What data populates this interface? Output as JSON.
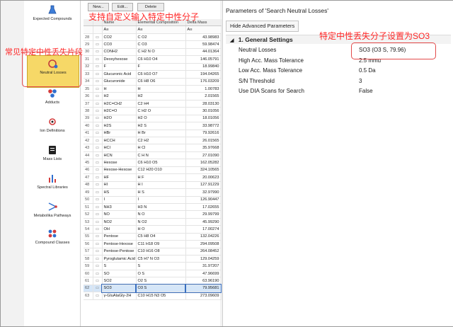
{
  "toolbar": {
    "new": "New...",
    "edit": "Edit...",
    "delete": "Delete"
  },
  "nav": [
    {
      "label": "Expected Compounds",
      "icon": "flask-icon"
    },
    {
      "label": "Adducts",
      "icon": "adducts-icon"
    },
    {
      "label": "Neutral Losses",
      "icon": "neutral-loss-icon"
    },
    {
      "label": "Ion Definitions",
      "icon": "ion-definitions-icon"
    },
    {
      "label": "Mass Lists",
      "icon": "mass-list-icon"
    },
    {
      "label": "Spectral Libraries",
      "icon": "spectral-library-icon"
    },
    {
      "label": "Metabolika Pathways",
      "icon": "pathway-icon"
    },
    {
      "label": "Compound Classes",
      "icon": "compound-classes-icon"
    }
  ],
  "table": {
    "headers": {
      "name": "Name",
      "composition": "Elemental Composition",
      "mass": "Delta Mass"
    },
    "filter_symbol": "A≡",
    "rows": [
      {
        "n": "28",
        "name": "CO2",
        "comp": "C O2",
        "mass": "43.98983"
      },
      {
        "n": "29",
        "name": "CO3",
        "comp": "C O3",
        "mass": "59.98474"
      },
      {
        "n": "30",
        "name": "CONH2",
        "comp": "C H2 N O",
        "mass": "44.01364"
      },
      {
        "n": "31",
        "name": "Deoxyhexose",
        "comp": "C6 H10 O4",
        "mass": "146.05791"
      },
      {
        "n": "32",
        "name": "F",
        "comp": "F",
        "mass": "18.99840"
      },
      {
        "n": "33",
        "name": "Glucuronic Acid",
        "comp": "C6 H10 O7",
        "mass": "194.04265"
      },
      {
        "n": "34",
        "name": "Glucuronide",
        "comp": "C6 H8 O6",
        "mass": "176.03209"
      },
      {
        "n": "35",
        "name": "H",
        "comp": "H",
        "mass": "1.00783"
      },
      {
        "n": "36",
        "name": "H2",
        "comp": "H2",
        "mass": "2.01565"
      },
      {
        "n": "37",
        "name": "H2C=CH2",
        "comp": "C2 H4",
        "mass": "28.03130"
      },
      {
        "n": "38",
        "name": "H2C=O",
        "comp": "C H2 O",
        "mass": "30.01056"
      },
      {
        "n": "39",
        "name": "H2O",
        "comp": "H2 O",
        "mass": "18.01056"
      },
      {
        "n": "40",
        "name": "H2S",
        "comp": "H2 S",
        "mass": "33.98772"
      },
      {
        "n": "41",
        "name": "HBr",
        "comp": "H Br",
        "mass": "79.92616"
      },
      {
        "n": "42",
        "name": "HCCH",
        "comp": "C2 H2",
        "mass": "26.01565"
      },
      {
        "n": "43",
        "name": "HCl",
        "comp": "H Cl",
        "mass": "35.97668"
      },
      {
        "n": "44",
        "name": "HCN",
        "comp": "C H N",
        "mass": "27.01090"
      },
      {
        "n": "45",
        "name": "Hexose",
        "comp": "C6 H10 O5",
        "mass": "162.05282"
      },
      {
        "n": "46",
        "name": "Hexose-Hexose",
        "comp": "C12 H20 O10",
        "mass": "324.10565"
      },
      {
        "n": "47",
        "name": "HF",
        "comp": "H F",
        "mass": "20.00623"
      },
      {
        "n": "48",
        "name": "HI",
        "comp": "H I",
        "mass": "127.91229"
      },
      {
        "n": "49",
        "name": "HS",
        "comp": "H S",
        "mass": "32.97990"
      },
      {
        "n": "50",
        "name": "I",
        "comp": "I",
        "mass": "126.90447"
      },
      {
        "n": "51",
        "name": "NH3",
        "comp": "H3 N",
        "mass": "17.02655"
      },
      {
        "n": "52",
        "name": "NO",
        "comp": "N O",
        "mass": "29.99799"
      },
      {
        "n": "53",
        "name": "NO2",
        "comp": "N O2",
        "mass": "45.99290"
      },
      {
        "n": "54",
        "name": "OH",
        "comp": "H O",
        "mass": "17.00274"
      },
      {
        "n": "55",
        "name": "Pentose",
        "comp": "C5 H8 O4",
        "mass": "132.04226"
      },
      {
        "n": "56",
        "name": "Pentose-Hexose",
        "comp": "C11 H18 O9",
        "mass": "294.09508"
      },
      {
        "n": "57",
        "name": "Pentose-Pentose",
        "comp": "C10 H16 O8",
        "mass": "264.08452"
      },
      {
        "n": "58",
        "name": "Pyroglutamic Acid",
        "comp": "C5 H7 N O3",
        "mass": "129.04259"
      },
      {
        "n": "59",
        "name": "S",
        "comp": "S",
        "mass": "31.97207"
      },
      {
        "n": "60",
        "name": "SO",
        "comp": "O S",
        "mass": "47.96699"
      },
      {
        "n": "61",
        "name": "SO2",
        "comp": "O2 S",
        "mass": "63.96190"
      },
      {
        "n": "62",
        "name": "SO3",
        "comp": "O3 S",
        "mass": "79.95681"
      },
      {
        "n": "63",
        "name": "γ-GluAlaGly-2H",
        "comp": "C10 H15 N3 O5",
        "mass": "273.09609"
      }
    ]
  },
  "params": {
    "title": "Parameters of 'Search Neutral Losses'",
    "hide_button": "Hide Advanced Parameters",
    "section": "1. General Settings",
    "rows": [
      {
        "name": "Neutral Losses",
        "value": "SO3 (O3 S, 79.96)"
      },
      {
        "name": "High Acc. Mass Tolerance",
        "value": "2.5 mmu"
      },
      {
        "name": "Low Acc. Mass Tolerance",
        "value": "0.5 Da"
      },
      {
        "name": "S/N Threshold",
        "value": "3"
      },
      {
        "name": "Use DIA Scans for Search",
        "value": "False"
      }
    ]
  },
  "annotations": {
    "custom_input": "支持自定义输入特定中性分子",
    "common_losses": "常见特定中性丢失片段",
    "set_so3": "特定中性丢失分子设置为SO3"
  },
  "colors": {
    "annotation": "#ff2626",
    "selection": "#d5e6f8",
    "active_nav": "#f6d867"
  }
}
